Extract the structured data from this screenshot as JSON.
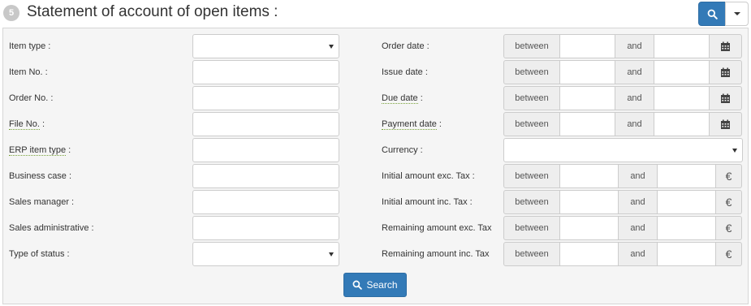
{
  "header": {
    "step_number": "5",
    "title": "Statement of account of open items :"
  },
  "left_fields": [
    {
      "label": "Item type :",
      "type": "select",
      "dotted": false
    },
    {
      "label": "Item No. :",
      "type": "text",
      "dotted": false
    },
    {
      "label": "Order No. :",
      "type": "text",
      "dotted": false
    },
    {
      "label": "File No.",
      "label_suffix": " :",
      "type": "text",
      "dotted": true
    },
    {
      "label": "ERP item type",
      "label_suffix": " :",
      "type": "text",
      "dotted": true
    },
    {
      "label": "Business case :",
      "type": "text",
      "dotted": false
    },
    {
      "label": "Sales manager :",
      "type": "text",
      "dotted": false
    },
    {
      "label": "Sales administrative :",
      "type": "text",
      "dotted": false
    },
    {
      "label": "Type of status :",
      "type": "select",
      "dotted": false
    }
  ],
  "right_fields": [
    {
      "label": "Order date :",
      "type": "date-range",
      "dotted": false
    },
    {
      "label": "Issue date :",
      "type": "date-range",
      "dotted": false
    },
    {
      "label": "Due date",
      "label_suffix": " :",
      "type": "date-range",
      "dotted": true
    },
    {
      "label": "Payment date",
      "label_suffix": " :",
      "type": "date-range",
      "dotted": true
    },
    {
      "label": "Currency :",
      "type": "select",
      "dotted": false
    },
    {
      "label": "Initial amount exc. Tax :",
      "type": "amount-range",
      "dotted": false
    },
    {
      "label": "Initial amount inc. Tax :",
      "type": "amount-range",
      "dotted": false
    },
    {
      "label": "Remaining amount exc. Tax",
      "type": "amount-range",
      "dotted": false
    },
    {
      "label": "Remaining amount inc. Tax",
      "type": "amount-range",
      "dotted": false
    }
  ],
  "range": {
    "between_label": "between",
    "and_label": "and",
    "currency_symbol": "€"
  },
  "search_button_label": "Search",
  "colors": {
    "primary": "#337ab7",
    "panel_bg": "#f5f5f5",
    "addon_bg": "#eeeeee",
    "dotted_underline": "#7aa33a"
  }
}
